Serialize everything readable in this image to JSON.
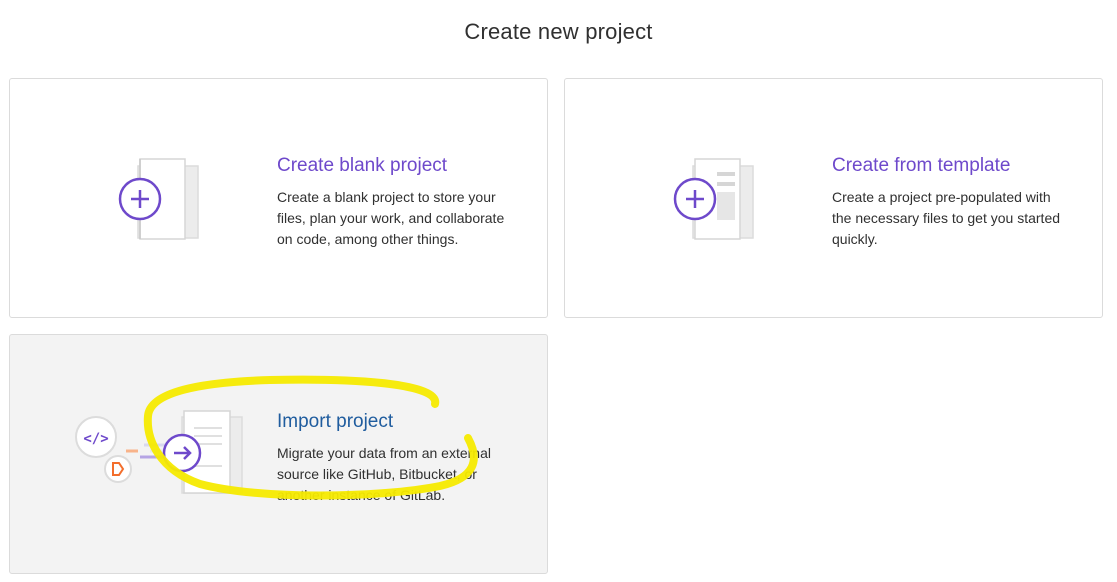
{
  "page": {
    "title": "Create new project"
  },
  "cards": [
    {
      "title": "Create blank project",
      "description": "Create a blank project to store your files, plan your work, and collaborate on code, among other things.",
      "icon": "plus-document-icon"
    },
    {
      "title": "Create from template",
      "description": "Create a project pre-populated with the necessary files to get you started quickly.",
      "icon": "template-document-icon"
    },
    {
      "title": "Import project",
      "description": "Migrate your data from an external source like GitHub, Bitbucket, or another instance of GitLab.",
      "icon": "import-document-icon"
    }
  ],
  "colors": {
    "accent_purple": "#6e49cb",
    "import_title_blue": "#1f5c9e",
    "highlight_yellow": "#f5ea00",
    "hover_background": "#f3f3f3",
    "border": "#dbdbdb"
  }
}
